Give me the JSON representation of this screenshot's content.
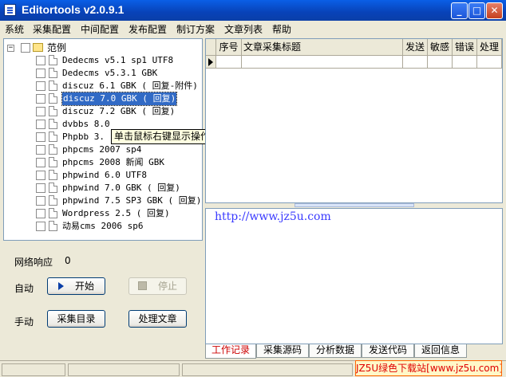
{
  "window": {
    "title": "Editortools v2.0.9.1",
    "minimize": "_",
    "maximize": "□",
    "close": "✕"
  },
  "menu": [
    "系统",
    "采集配置",
    "中间配置",
    "发布配置",
    "制订方案",
    "文章列表",
    "帮助"
  ],
  "tree": {
    "root": "范例",
    "items": [
      "Dedecms v5.1 sp1 UTF8",
      "Dedecms v5.3.1 GBK",
      "discuz 6.1 GBK ( 回复-附件)",
      "discuz 7.0 GBK ( 回复)",
      "discuz 7.2 GBK ( 回复)",
      "dvbbs 8.0",
      "Phpbb 3.",
      "phpcms 2007 sp4",
      "phpcms 2008 新闻 GBK",
      "phpwind 6.0 UTF8",
      "phpwind 7.0 GBK ( 回复)",
      "phpwind 7.5 SP3 GBK ( 回复)",
      "Wordpress 2.5 ( 回复)",
      "动易cms 2006 sp6"
    ],
    "selected_index": 3,
    "tooltip": "单击鼠标右键显示操作菜单"
  },
  "grid": {
    "columns": [
      "序号",
      "文章采集标题",
      "发送",
      "敏感",
      "错误",
      "处理"
    ]
  },
  "left": {
    "network_label": "网络响应",
    "network_value": "0",
    "auto_label": "自动",
    "start_button": "开始",
    "stop_button": "停止",
    "manual_label": "手动",
    "collect_dir_button": "采集目录",
    "process_button": "处理文章"
  },
  "log": {
    "text": "http://www.jz5u.com"
  },
  "tabs": [
    "工作记录",
    "采集源码",
    "分析数据",
    "发送代码",
    "返回信息"
  ],
  "active_tab": 0,
  "watermark": "JZ5U绿色下载站[www.jz5u.com]",
  "colors": {
    "title_bar": "#0842b8",
    "selection": "#316ac5",
    "active_tab_text": "#cc0000",
    "log_text": "#3a3aff"
  }
}
